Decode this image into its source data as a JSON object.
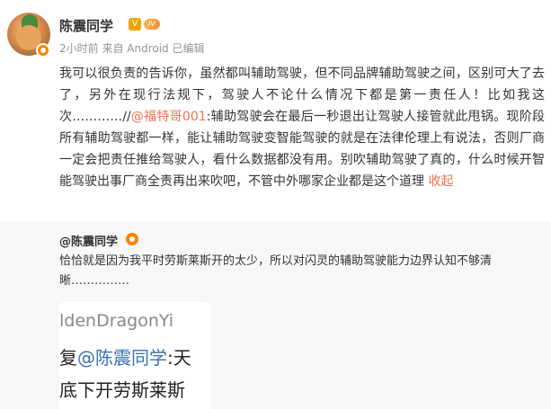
{
  "user": {
    "name": "陈震同学",
    "vip_mark": "V",
    "level_text": "IV",
    "meta": "2小时前 来自 Android 已编辑"
  },
  "post": {
    "text_before": "我可以很负责的告诉你，虽然都叫辅助驾驶，但不同品牌辅助驾驶之间，区别可大了去了，另外在现行法规下，驾驶人不论什么情况下都是第一责任人！比如我这次…………//",
    "mention": "@福特哥001",
    "text_after": ":辅助驾驶会在最后一秒退出让驾驶人接管就此甩锅。现阶段所有辅助驾驶都一样，能让辅助驾驶变智能驾驶的就是在法律伦理上有说法，否则厂商一定会把责任推给驾驶人，看什么数据都没有用。别吹辅助驾驶了真的，什么时候开智能驾驶出事厂商全责再出来吹吧，不管中外哪家企业都是这个道理",
    "collapse": "收起"
  },
  "quote": {
    "name": "@陈震同学",
    "text": "恰恰就是因为我平时劳斯莱斯开的太少，所以对闪灵的辅助驾驶能力边界认知不够清晰……………",
    "image": {
      "line1": "ldenDragonYi",
      "line2_prefix": "复",
      "line2_mention": "@陈震同学",
      "line2_suffix": ":天",
      "line3": "底下开劳斯莱斯"
    }
  },
  "colors": {
    "link": "#eb7350",
    "verified": "#ff8200",
    "quote_bg": "#f7f7f7"
  }
}
